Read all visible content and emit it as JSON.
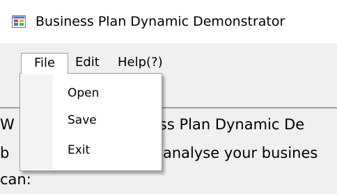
{
  "window": {
    "title": "Business Plan Dynamic Demonstrator",
    "icon": "application-icon"
  },
  "menubar": {
    "items": [
      {
        "label": "File",
        "state": "open"
      },
      {
        "label": "Edit"
      },
      {
        "label": "Help(?)"
      }
    ]
  },
  "file_menu": {
    "items": [
      {
        "label": "Open"
      },
      {
        "label": "Save"
      },
      {
        "label": "Exit"
      }
    ]
  },
  "content": {
    "lines": [
      "ess Plan Dynamic De",
      "analyse your busines",
      "can:"
    ],
    "line_starts": [
      "W",
      "b"
    ]
  },
  "colors": {
    "titlebar": "#ffffff",
    "window_background": "#f0f0f0",
    "menu_background": "#ffffff",
    "menu_border": "#9a9a9a",
    "menu_gutter": "#f3f3f3"
  }
}
